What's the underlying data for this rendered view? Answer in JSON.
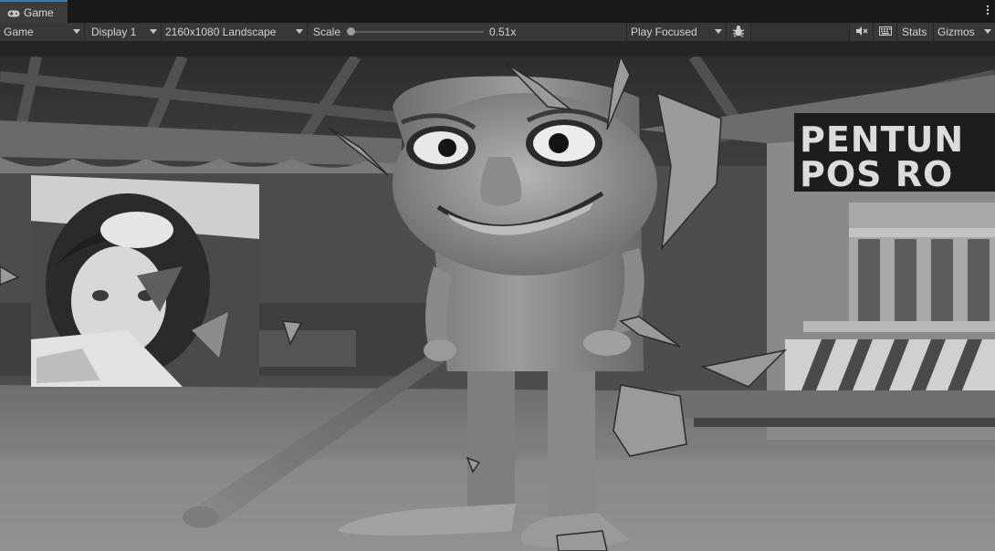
{
  "tab": {
    "title": "Game",
    "icon": "gamepad-icon"
  },
  "toolbar": {
    "view_mode": "Game",
    "display": "Display 1",
    "resolution": "2160x1080 Landscape",
    "scale_label": "Scale",
    "scale_value": "0.51x",
    "scale_fraction": 0.0,
    "play_mode": "Play Focused",
    "stats_label": "Stats",
    "gizmos_label": "Gizmos"
  },
  "scene": {
    "sign_line1": "PENTUN",
    "sign_line2": "POS RO"
  }
}
